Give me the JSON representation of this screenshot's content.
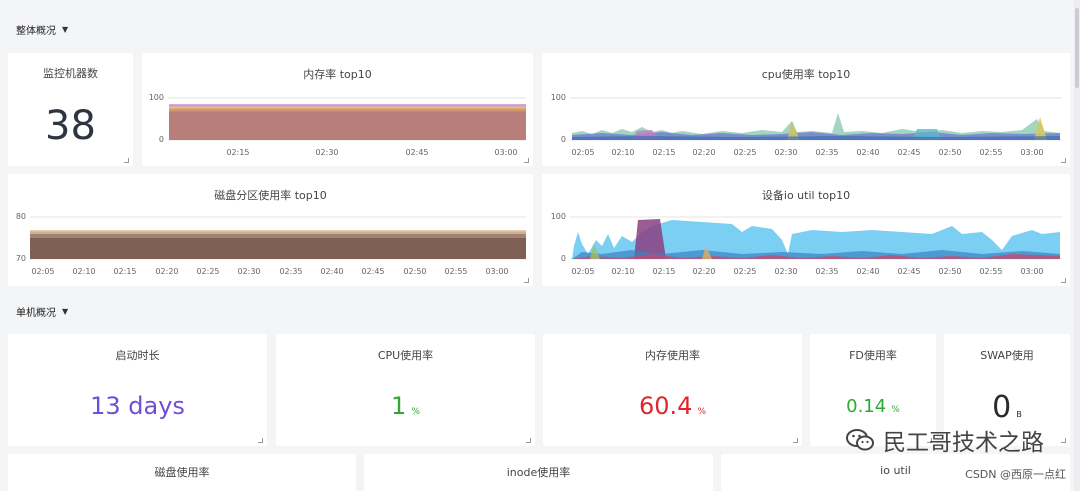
{
  "overview_section": {
    "title": "整体概况",
    "caret": "▼"
  },
  "single_section": {
    "title": "单机概况",
    "caret": "▼"
  },
  "panels": {
    "machines": {
      "title": "监控机器数",
      "value": "38"
    },
    "mem_top": {
      "title": "内存率 top10",
      "y_max": "100",
      "y_min": "0",
      "x_ticks": [
        "02:15",
        "02:30",
        "02:45",
        "03:00"
      ]
    },
    "cpu_top": {
      "title": "cpu使用率 top10",
      "y_max": "100",
      "y_min": "0",
      "x_ticks": [
        "02:05",
        "02:10",
        "02:15",
        "02:20",
        "02:25",
        "02:30",
        "02:35",
        "02:40",
        "02:45",
        "02:50",
        "02:55",
        "03:00"
      ]
    },
    "disk_top": {
      "title": "磁盘分区使用率 top10",
      "y_max": "80",
      "y_min": "70",
      "x_ticks": [
        "02:05",
        "02:10",
        "02:15",
        "02:20",
        "02:25",
        "02:30",
        "02:35",
        "02:40",
        "02:45",
        "02:50",
        "02:55",
        "03:00"
      ]
    },
    "io_top": {
      "title": "设备io util top10",
      "y_max": "100",
      "y_min": "0",
      "x_ticks": [
        "02:05",
        "02:10",
        "02:15",
        "02:20",
        "02:25",
        "02:30",
        "02:35",
        "02:40",
        "02:45",
        "02:50",
        "02:55",
        "03:00"
      ]
    },
    "uptime": {
      "title": "启动时长",
      "value": "13 days",
      "color": "#6e4fd8"
    },
    "cpu_usage": {
      "title": "CPU使用率",
      "value": "1",
      "unit": "%",
      "color": "#2ea82e"
    },
    "mem_usage": {
      "title": "内存使用率",
      "value": "60.4",
      "unit": "%",
      "color": "#e0262b"
    },
    "fd_usage": {
      "title": "FD使用率",
      "value": "0.14",
      "unit": "%",
      "color": "#2ea82e"
    },
    "swap_usage": {
      "title": "SWAP使用",
      "value": "0",
      "unit": "B",
      "color": "#2a2a2a"
    },
    "disk_usage": {
      "title": "磁盘使用率"
    },
    "inode_usage": {
      "title": "inode使用率"
    },
    "io_util": {
      "title": "io util"
    }
  },
  "watermark": {
    "text": "民工哥技术之路",
    "icon": "wechat-icon"
  },
  "credit": "CSDN @西原一点红"
}
